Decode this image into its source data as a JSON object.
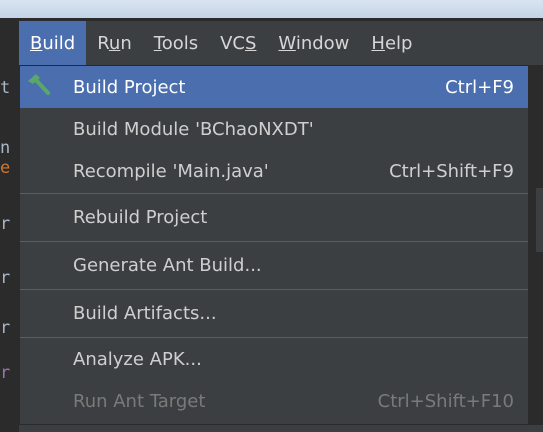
{
  "menubar": {
    "items": [
      {
        "label": "Build",
        "active": true
      },
      {
        "label": "Run"
      },
      {
        "label": "Tools"
      },
      {
        "label": "VCS"
      },
      {
        "label": "Window"
      },
      {
        "label": "Help"
      }
    ]
  },
  "dropdown": {
    "items": [
      {
        "label": "Build Project",
        "shortcut": "Ctrl+F9",
        "selected": true,
        "icon": "hammer-icon"
      },
      {
        "label": "Build Module 'BChaoNXDT'",
        "shortcut": ""
      },
      {
        "label": "Recompile 'Main.java'",
        "shortcut": "Ctrl+Shift+F9"
      },
      {
        "label": "Rebuild Project",
        "shortcut": ""
      },
      {
        "label": "Generate Ant Build...",
        "shortcut": ""
      },
      {
        "label": "Build Artifacts...",
        "shortcut": ""
      },
      {
        "label": "Analyze APK...",
        "shortcut": ""
      },
      {
        "label": "Run Ant Target",
        "shortcut": "Ctrl+Shift+F10",
        "disabled": true
      }
    ]
  },
  "colors": {
    "selected_bg": "#4b6eaf",
    "menu_bg": "#3c3f41",
    "hammer_green": "#59a869"
  }
}
